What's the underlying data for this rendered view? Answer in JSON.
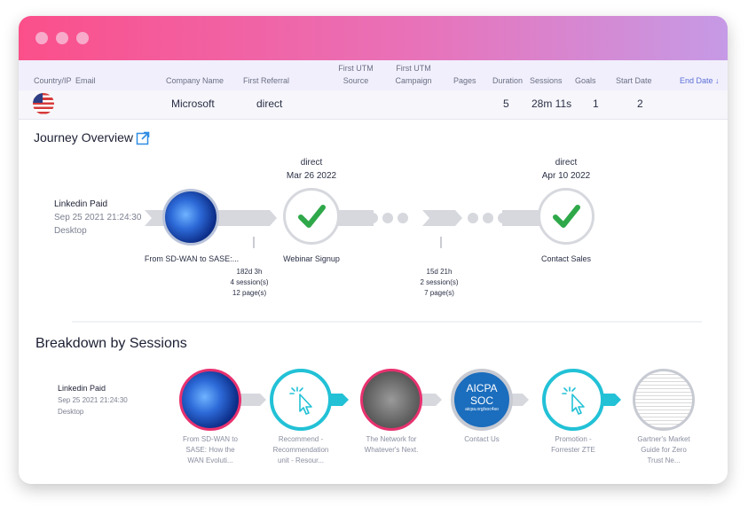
{
  "table": {
    "headers": {
      "country": "Country/IP",
      "email": "Email",
      "company": "Company Name",
      "referral": "First Referral",
      "utm_source_1": "First UTM",
      "utm_source_2": "Source",
      "utm_campaign_1": "First UTM",
      "utm_campaign_2": "Campaign",
      "pages": "Pages",
      "duration": "Duration",
      "sessions": "Sessions",
      "goals": "Goals",
      "start": "Start Date",
      "end": "End Date ↓"
    },
    "row": {
      "company": "Microsoft",
      "referral": "direct",
      "pages": "5",
      "duration": "28m 11s",
      "sessions": "1",
      "goals": "2"
    }
  },
  "journey": {
    "title": "Journey Overview",
    "start": {
      "source": "Linkedin Paid",
      "date": "Sep 25 2021 21:24:30",
      "device": "Desktop"
    },
    "node1_label": "From SD-WAN to SASE:...",
    "node2": {
      "ref": "direct",
      "date": "Mar 26 2022",
      "label": "Webinar Signup"
    },
    "node3": {
      "ref": "direct",
      "date": "Apr 10 2022",
      "label": "Contact Sales"
    },
    "gap1": {
      "time": "182d 3h",
      "sessions": "4 session(s)",
      "pages": "12 page(s)"
    },
    "gap2": {
      "time": "15d 21h",
      "sessions": "2 session(s)",
      "pages": "7 page(s)"
    }
  },
  "breakdown": {
    "title": "Breakdown by Sessions",
    "start": {
      "source": "Linkedin Paid",
      "date": "Sep 25 2021 21:24:30",
      "device": "Desktop"
    },
    "aicpa_1": "AICPA",
    "aicpa_2": "SOC",
    "aicpa_3": "aicpa.org/soc4so",
    "items": [
      {
        "l1": "From SD-WAN to",
        "l2": "SASE: How the",
        "l3": "WAN Evoluti..."
      },
      {
        "l1": "Recommend -",
        "l2": "Recommendation",
        "l3": "unit - Resour..."
      },
      {
        "l1": "The Network for",
        "l2": "Whatever's Next.",
        "l3": ""
      },
      {
        "l1": "Contact Us",
        "l2": "",
        "l3": ""
      },
      {
        "l1": "Promotion -",
        "l2": "Forrester ZTE",
        "l3": ""
      },
      {
        "l1": "Gartner's Market",
        "l2": "Guide for Zero",
        "l3": "Trust Ne..."
      }
    ]
  },
  "colors": {
    "accent_pink": "#e8316f",
    "teal": "#22c1d6",
    "check_green": "#2fa84a"
  }
}
